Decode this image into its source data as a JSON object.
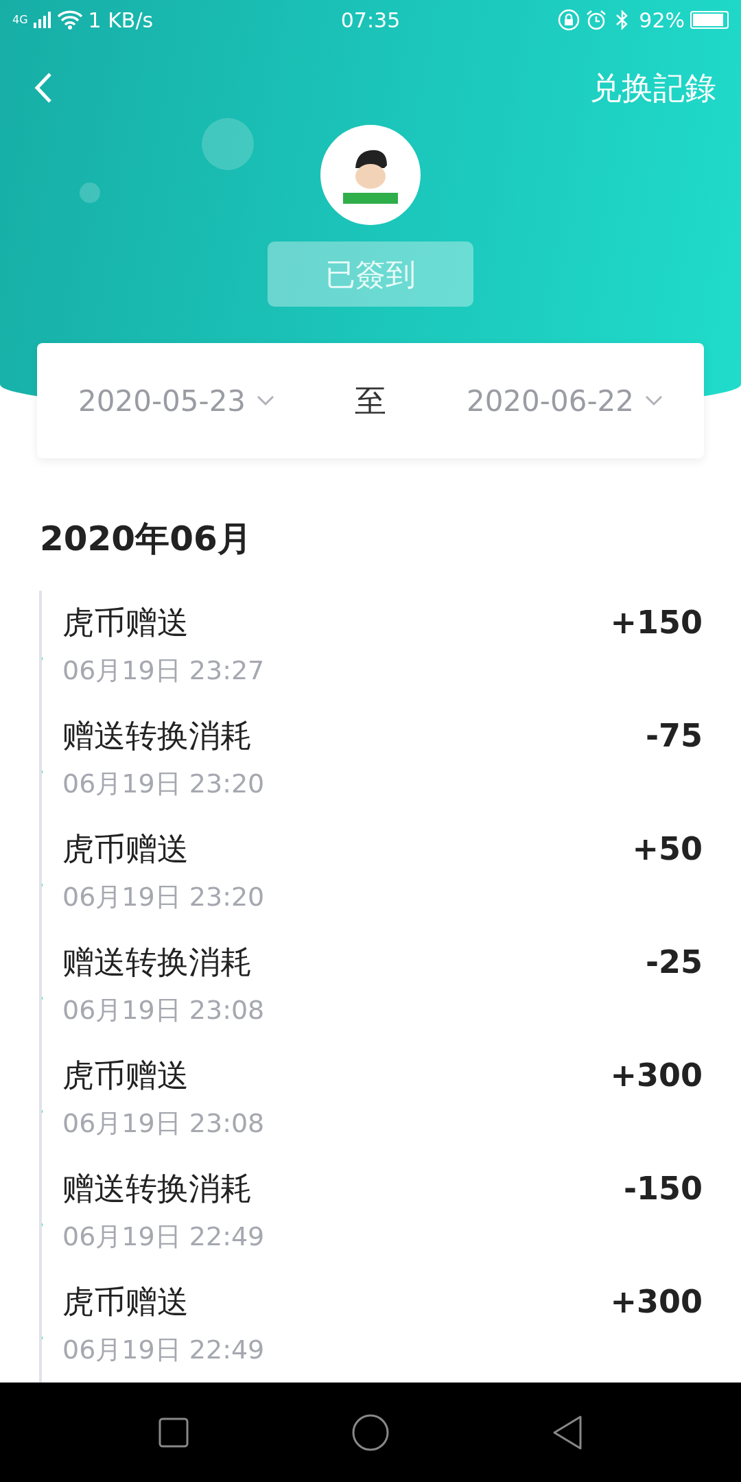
{
  "status_bar": {
    "network": "4G",
    "speed": "1 KB/s",
    "time": "07:35",
    "battery": "92%"
  },
  "header": {
    "title": "兑换記錄",
    "checkin_button": "已簽到"
  },
  "date_range": {
    "start": "2020-05-23",
    "separator": "至",
    "end": "2020-06-22"
  },
  "month": "2020年06月",
  "records": [
    {
      "title": "虎币赠送",
      "amount": "+150",
      "time": "06月19日 23:27"
    },
    {
      "title": "赠送转换消耗",
      "amount": "-75",
      "time": "06月19日 23:20"
    },
    {
      "title": "虎币赠送",
      "amount": "+50",
      "time": "06月19日 23:20"
    },
    {
      "title": "赠送转换消耗",
      "amount": "-25",
      "time": "06月19日 23:08"
    },
    {
      "title": "虎币赠送",
      "amount": "+300",
      "time": "06月19日 23:08"
    },
    {
      "title": "赠送转换消耗",
      "amount": "-150",
      "time": "06月19日 22:49"
    },
    {
      "title": "虎币赠送",
      "amount": "+300",
      "time": "06月19日 22:49"
    }
  ]
}
